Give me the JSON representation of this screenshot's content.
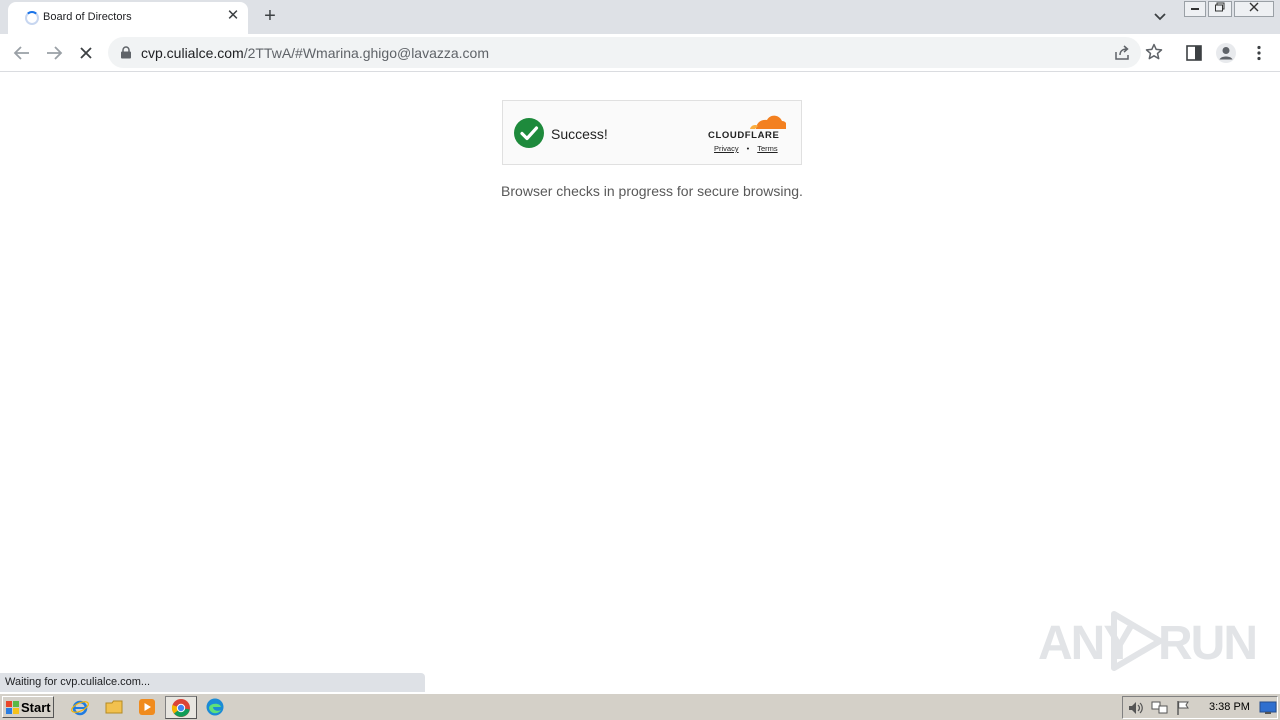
{
  "browser": {
    "tab_title": "Board of Directors",
    "tab_close": "✕",
    "new_tab": "+",
    "url_host": "cvp.culialce.com",
    "url_path": "/2TTwA/#Wmarina.ghigo@lavazza.com"
  },
  "widget": {
    "status": "Success!",
    "brand": "CLOUDFLARE",
    "privacy": "Privacy",
    "separator": "•",
    "terms": "Terms",
    "check_color": "#1e8a3c",
    "brand_color": "#f38020"
  },
  "page": {
    "message": "Browser checks in progress for secure browsing."
  },
  "status_bar": {
    "text": "Waiting for cvp.culialce.com..."
  },
  "watermark": {
    "left": "ANY",
    "right": "RUN"
  },
  "taskbar": {
    "start": "Start",
    "clock": "3:38 PM"
  },
  "icons": [
    "tab-spinner-icon",
    "close-icon",
    "plus-icon",
    "chevron-down-icon",
    "back-arrow-icon",
    "forward-arrow-icon",
    "stop-icon",
    "lock-icon",
    "share-icon",
    "star-icon",
    "side-panel-icon",
    "profile-icon",
    "kebab-menu-icon",
    "checkmark-icon",
    "cloudflare-logo-icon",
    "windows-flag-icon",
    "ie-icon",
    "explorer-icon",
    "media-player-icon",
    "chrome-icon",
    "edge-icon",
    "speaker-icon",
    "network-icon",
    "flag-icon",
    "monitor-icon"
  ]
}
